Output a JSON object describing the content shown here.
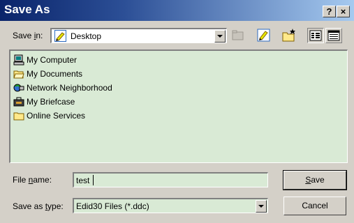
{
  "window": {
    "title": "Save As",
    "help_button": "?",
    "close_button": "×"
  },
  "save_in": {
    "label_pre": "Save ",
    "label_accel": "i",
    "label_post": "n:",
    "value": "Desktop",
    "icon": "desktop-icon"
  },
  "toolbar": {
    "buttons": [
      "up-one-level-icon",
      "desktop-icon",
      "new-folder-icon",
      "list-view-icon",
      "details-view-icon"
    ]
  },
  "file_list": {
    "items": [
      {
        "label": "My Computer",
        "icon": "computer-icon"
      },
      {
        "label": "My Documents",
        "icon": "folder-open-icon"
      },
      {
        "label": "Network Neighborhood",
        "icon": "network-icon"
      },
      {
        "label": "My Briefcase",
        "icon": "briefcase-icon"
      },
      {
        "label": "Online Services",
        "icon": "folder-icon"
      }
    ]
  },
  "file_name": {
    "label_pre": "File ",
    "label_accel": "n",
    "label_post": "ame:",
    "value": "test"
  },
  "save_as_type": {
    "label_pre": "Save as ",
    "label_accel": "t",
    "label_post": "ype:",
    "value": "Edid30 Files (*.ddc)"
  },
  "buttons": {
    "save_accel": "S",
    "save_rest": "ave",
    "cancel": "Cancel"
  }
}
